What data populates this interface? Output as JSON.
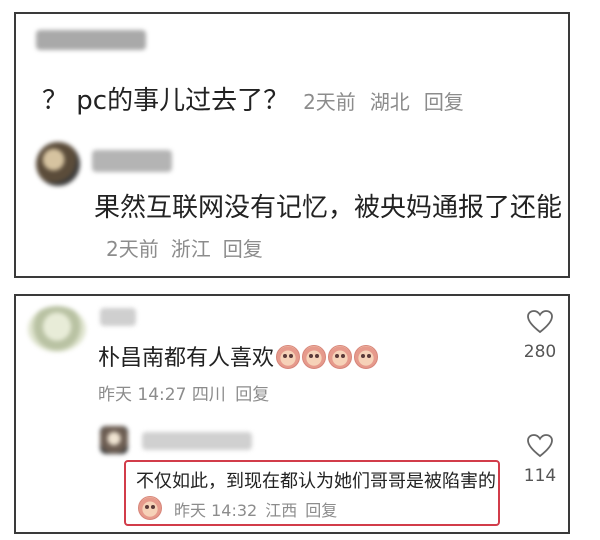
{
  "panel_top": {
    "comment_1": {
      "text": "？ pc的事儿过去了？",
      "time": "2天前",
      "location": "湖北",
      "reply_label": "回复"
    },
    "comment_2": {
      "text": "果然互联网没有记忆，被央妈通报了还能",
      "time": "2天前",
      "location": "浙江",
      "reply_label": "回复"
    }
  },
  "panel_bottom": {
    "comment_1": {
      "text": "朴昌南都有人喜欢",
      "emoji_count": 4,
      "emoji_icon": "crying-face-emoji",
      "time": "昨天 14:27",
      "location": "四川",
      "reply_label": "回复",
      "likes": "280"
    },
    "comment_2": {
      "text": "不仅如此，到现在都认为她们哥哥是被陷害的",
      "emoji_icon": "crying-face-emoji",
      "time": "昨天 14:32",
      "location": "江西",
      "reply_label": "回复",
      "likes": "114"
    }
  },
  "colors": {
    "highlight_border": "#d23c4a",
    "meta_text": "#8c8c8c",
    "panel_border": "#3a3a3a"
  }
}
